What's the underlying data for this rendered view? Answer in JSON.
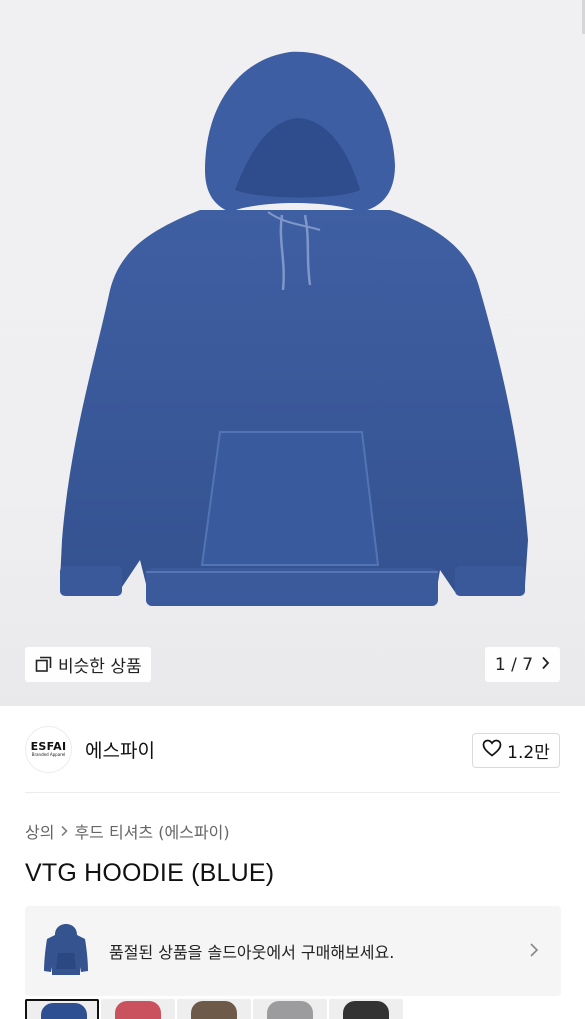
{
  "gallery": {
    "similar_label": "비슷한 상품",
    "page_current": "1",
    "page_sep": " / ",
    "page_total": "7",
    "product_color": "#3a5a9c"
  },
  "seller": {
    "logo_text": "ESFAI",
    "logo_subtext": "Branded Apparel",
    "name": "에스파이",
    "likes": "1.2만"
  },
  "breadcrumb": {
    "category": "상의",
    "subcategory": "후드 티셔츠 (에스파이)"
  },
  "product": {
    "title": "VTG HOODIE (BLUE)"
  },
  "soldout_banner": {
    "message": "품절된 상품을 솔드아웃에서 구매해보세요."
  },
  "color_swatches": [
    {
      "name": "blue",
      "color": "#2f4f93"
    },
    {
      "name": "red",
      "color": "#c9525e"
    },
    {
      "name": "brown",
      "color": "#6d5a49"
    },
    {
      "name": "gray",
      "color": "#9c9c9e"
    },
    {
      "name": "black",
      "color": "#333333"
    }
  ]
}
